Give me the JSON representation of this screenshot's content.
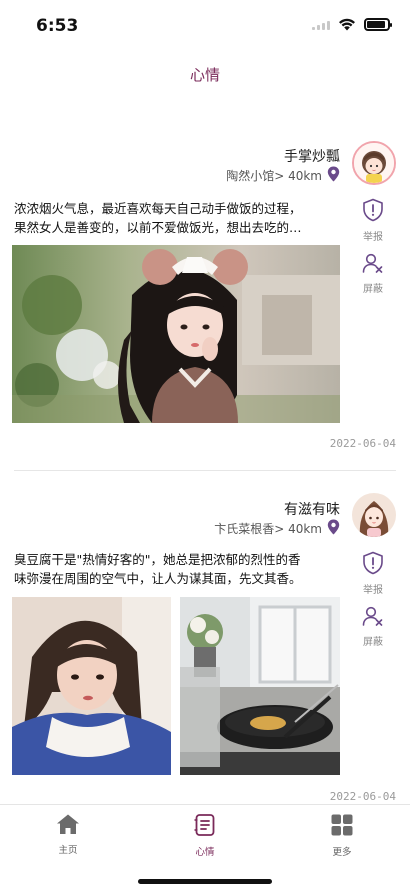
{
  "status": {
    "time": "6:53",
    "battery_level": 0.9
  },
  "header": {
    "title": "心情"
  },
  "posts": [
    {
      "author": "手掌炒瓢",
      "location": "陶然小馆> 40km",
      "text_line1": "浓浓烟火气息，最近喜欢每天自己动手做饭的过程，",
      "text_line2": "果然女人是善变的，以前不爱做饭光，想出去吃的…",
      "report_label": "举报",
      "block_label": "屏蔽",
      "date": "2022-06-04",
      "photos": [
        "girl-with-bear-ears-headband"
      ]
    },
    {
      "author": "有滋有味",
      "location": "卞氏菜根香> 40km",
      "text_line1": "臭豆腐干是\"热情好客的\"，她总是把浓郁的烈性的香",
      "text_line2": "味弥漫在周围的空气中，让人为谋其面，先文其香。",
      "report_label": "举报",
      "block_label": "屏蔽",
      "date": "2022-06-04",
      "photos": [
        "girl-portrait-blue-jacket",
        "wok-cooking-on-stove"
      ]
    }
  ],
  "tabbar": {
    "items": [
      {
        "label": "主页",
        "icon": "home-icon",
        "active": false
      },
      {
        "label": "心情",
        "icon": "mood-notes-icon",
        "active": true
      },
      {
        "label": "更多",
        "icon": "grid-icon",
        "active": false
      }
    ]
  },
  "colors": {
    "accent": "#7a2a5a",
    "action_icon": "#6a4a8a",
    "date": "#9a9a9a"
  }
}
